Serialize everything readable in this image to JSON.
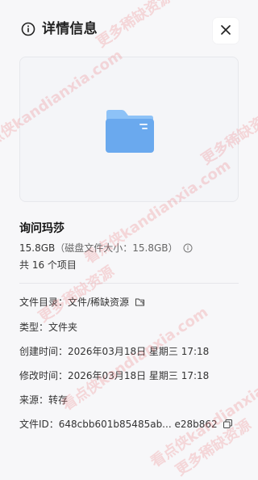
{
  "header": {
    "title": "详情信息",
    "info_icon": "info-circle-icon",
    "close_icon": "close-icon"
  },
  "preview": {
    "icon": "folder-icon",
    "folder_color": "#6aa9ee",
    "folder_tab_color": "#8dc2f7"
  },
  "item": {
    "name": "询问玛莎",
    "size": "15.8GB",
    "disk_size": "（磁盘文件大小：15.8GB）",
    "count": "共 16 个项目"
  },
  "details": {
    "directory_label": "文件目录：",
    "directory_value": "文件/稀缺资源",
    "directory_icon": "open-location-icon",
    "type_label": "类型：",
    "type_value": "文件夹",
    "created_label": "创建时间：",
    "created_value": "2026年03月18日 星期三 17:18",
    "modified_label": "修改时间：",
    "modified_value": "2026年03月18日 星期三 17:18",
    "source_label": "来源：",
    "source_value": "转存",
    "fileid_label": "文件ID：",
    "fileid_value": "648cbb601b85485ab... e28b862",
    "copy_icon": "copy-icon"
  },
  "watermarks": [
    "更多稀缺资源",
    "看点侠kandianxia.com",
    "更多稀缺资源",
    "看点侠kandianxia.com",
    "更多稀缺资源",
    "看点侠kandianxia.com",
    "看点侠kandianxia.com",
    "更多稀缺资源"
  ]
}
